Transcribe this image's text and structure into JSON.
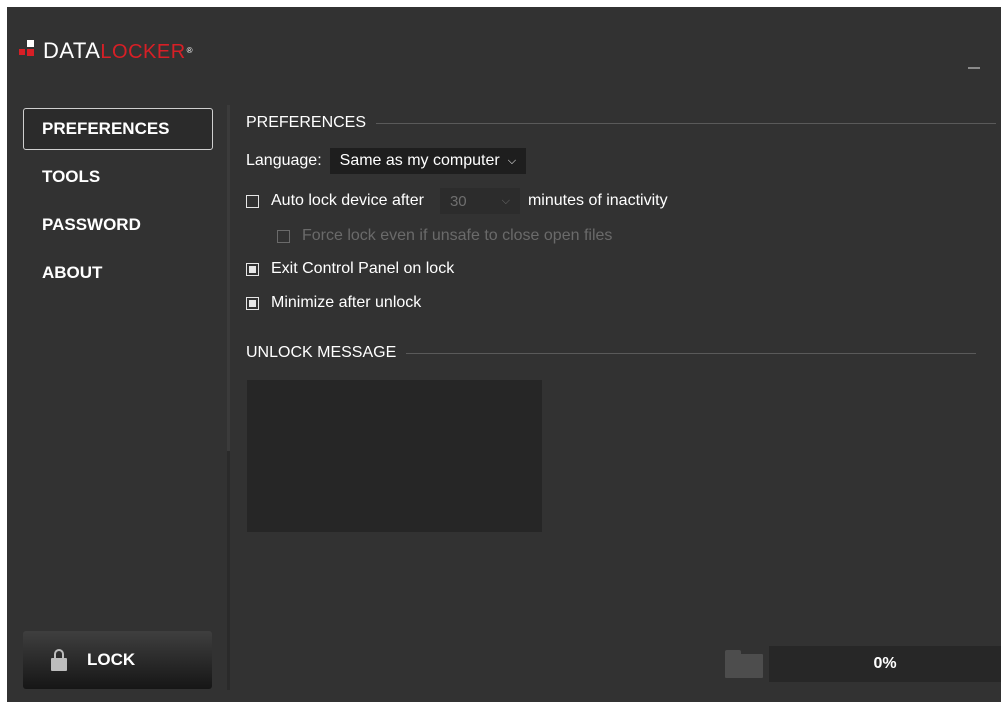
{
  "logo": {
    "part_a": "DATA",
    "part_b": "LOCKER",
    "reg": "®"
  },
  "window": {
    "minimize_icon": "minimize-icon"
  },
  "nav": {
    "items": [
      {
        "label": "PREFERENCES",
        "active": true
      },
      {
        "label": "TOOLS",
        "active": false
      },
      {
        "label": "PASSWORD",
        "active": false
      },
      {
        "label": "ABOUT",
        "active": false
      }
    ],
    "lock": {
      "label": "LOCK",
      "icon": "lock-icon"
    }
  },
  "preferences": {
    "title": "PREFERENCES",
    "language": {
      "label": "Language:",
      "value": "Same as my computer"
    },
    "auto_lock": {
      "checked": false,
      "label": "Auto lock device after",
      "minutes": "30",
      "suffix": "minutes of inactivity"
    },
    "force_lock": {
      "checked": false,
      "disabled": true,
      "label": "Force lock even if unsafe to close open files"
    },
    "exit_on_lock": {
      "checked": true,
      "label": "Exit Control Panel on lock"
    },
    "minimize_after_unlock": {
      "checked": true,
      "label": "Minimize after unlock"
    }
  },
  "unlock_message": {
    "title": "UNLOCK MESSAGE",
    "text": ""
  },
  "status": {
    "progress_text": "0%",
    "progress_value": 0,
    "folder_icon": "folder-icon"
  },
  "colors": {
    "background": "#323232",
    "accent_red": "#d71f26",
    "text": "#ffffff",
    "disabled": "#6a6a6a"
  }
}
